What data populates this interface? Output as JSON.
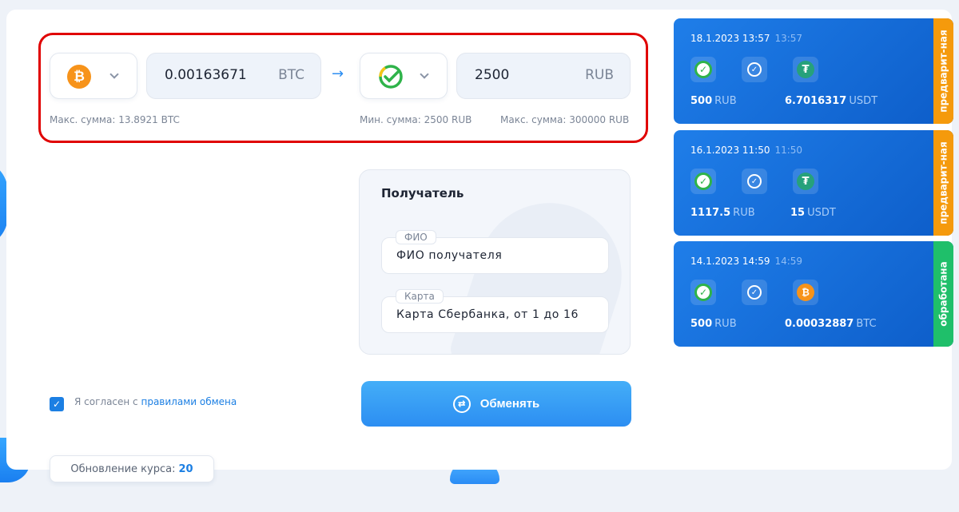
{
  "exchange": {
    "from": {
      "coin_icon": "bitcoin-icon",
      "amount": "0.00163671",
      "currency": "BTC",
      "hint_max": "Макс. сумма: 13.8921 BTC"
    },
    "to": {
      "coin_icon": "sberbank-icon",
      "amount": "2500",
      "currency": "RUB",
      "hint_min": "Мин. сумма: 2500 RUB",
      "hint_max": "Макс. сумма: 300000 RUB"
    }
  },
  "recipient": {
    "title": "Получатель",
    "name_label": "ФИО",
    "name_placeholder": "ФИО получателя",
    "card_label": "Карта",
    "card_placeholder": "Карта Сбербанка, от 1 до 16"
  },
  "agreement": {
    "text": "Я согласен с ",
    "link": "правилами обмена",
    "checked": true
  },
  "submit": {
    "label": "Обменять"
  },
  "rate_update": {
    "label": "Обновление курса:",
    "value": "20"
  },
  "transactions": [
    {
      "date": "18.1.2023 13:57",
      "time": "13:57",
      "from_icon": "sberbank-icon",
      "to_icon": "tether-icon",
      "from_amount": "500",
      "from_currency": "RUB",
      "to_amount": "6.7016317",
      "to_currency": "USDT",
      "status": "предварит-ная",
      "status_color": "#f59a0c"
    },
    {
      "date": "16.1.2023 11:50",
      "time": "11:50",
      "from_icon": "sberbank-icon",
      "to_icon": "tether-icon",
      "from_amount": "1117.5",
      "from_currency": "RUB",
      "to_amount": "15",
      "to_currency": "USDT",
      "status": "предварит-ная",
      "status_color": "#f59a0c"
    },
    {
      "date": "14.1.2023 14:59",
      "time": "14:59",
      "from_icon": "sberbank-icon",
      "to_icon": "bitcoin-icon",
      "from_amount": "500",
      "from_currency": "RUB",
      "to_amount": "0.00032887",
      "to_currency": "BTC",
      "status": "обработана",
      "status_color": "#1fbf6a"
    }
  ],
  "colors": {
    "accent": "#2c8ef2",
    "highlight_border": "#e00000",
    "card_blue": "#1572db"
  }
}
